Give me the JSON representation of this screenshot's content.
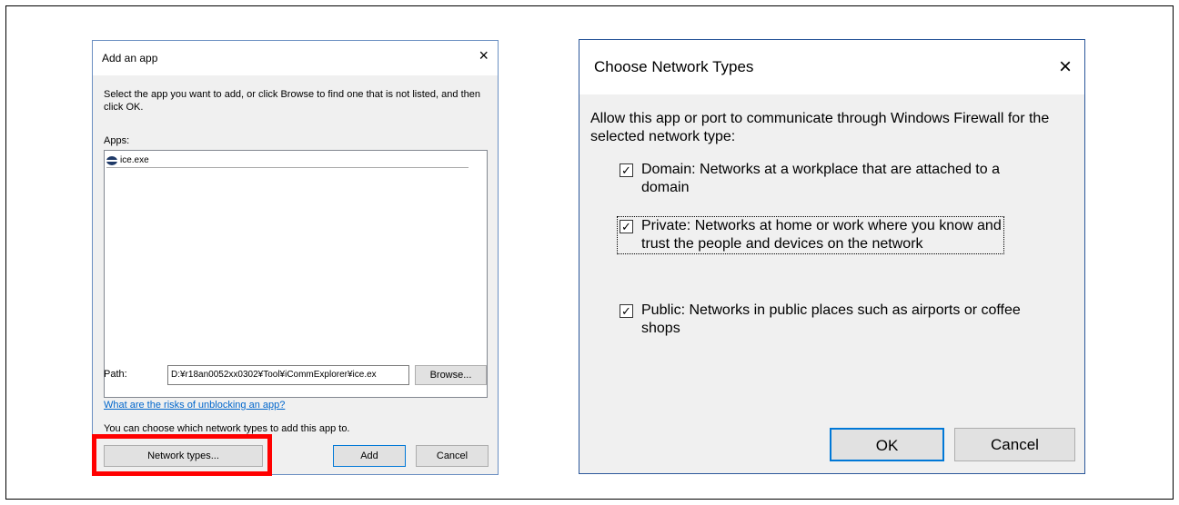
{
  "add_app": {
    "title": "Add an app",
    "close": "×",
    "description": "Select the app you want to add, or click Browse to find one that is not listed, and then click OK.",
    "apps_label": "Apps:",
    "apps": [
      {
        "icon": "app-icon",
        "name": "ice.exe"
      }
    ],
    "path_label": "Path:",
    "path_value": "D:¥r18an0052xx0302¥Tool¥iCommExplorer¥ice.ex",
    "browse_label": "Browse...",
    "risks_link": "What are the risks of unblocking an app?",
    "network_hint": "You can choose which network types to add this app to.",
    "network_types_label": "Network types...",
    "add_label": "Add",
    "cancel_label": "Cancel"
  },
  "network_types": {
    "title": "Choose Network Types",
    "close": "×",
    "intro": "Allow this app or port to communicate through Windows Firewall for the selected network type:",
    "options": [
      {
        "label": "Domain: Networks at a workplace that are attached to a domain",
        "checked": true
      },
      {
        "label": "Private:  Networks at home or work where you know and trust the people and devices on the network",
        "checked": true
      },
      {
        "label": "Public:  Networks in public places such as airports or coffee shops",
        "checked": true
      }
    ],
    "check_glyph": "✓",
    "ok_label": "OK",
    "cancel_label": "Cancel"
  },
  "colors": {
    "highlight": "#ff0000",
    "link": "#0066cc",
    "accent": "#0078d7"
  }
}
